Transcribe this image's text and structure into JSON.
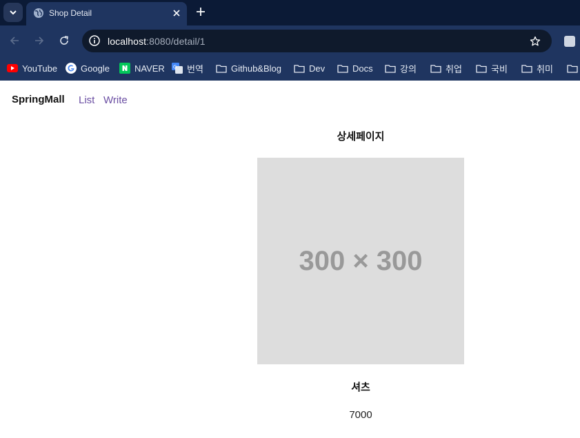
{
  "browser": {
    "tab": {
      "title": "Shop Detail"
    },
    "url": {
      "host": "localhost",
      "path": ":8080/detail/1"
    },
    "bookmarks": [
      {
        "label": "YouTube",
        "icon": "youtube-icon"
      },
      {
        "label": "Google",
        "icon": "google-icon"
      },
      {
        "label": "NAVER",
        "icon": "naver-icon"
      },
      {
        "label": "번역",
        "icon": "translate-icon"
      },
      {
        "label": "Github&Blog",
        "icon": "folder-icon"
      },
      {
        "label": "Dev",
        "icon": "folder-icon"
      },
      {
        "label": "Docs",
        "icon": "folder-icon"
      },
      {
        "label": "강의",
        "icon": "folder-icon"
      },
      {
        "label": "취업",
        "icon": "folder-icon"
      },
      {
        "label": "국비",
        "icon": "folder-icon"
      },
      {
        "label": "취미",
        "icon": "folder-icon"
      }
    ]
  },
  "site": {
    "brand": "SpringMall",
    "nav": [
      "List",
      "Write"
    ]
  },
  "detail": {
    "heading": "상세페이지",
    "image_placeholder": "300 × 300",
    "product_name": "셔츠",
    "price": "7000"
  },
  "colors": {
    "tabstrip": "#0b1a36",
    "toolbar": "#1f3560",
    "omnibox": "#0f1a2c",
    "nav_link": "#6b4fa3",
    "image_bg": "#dddddd"
  }
}
